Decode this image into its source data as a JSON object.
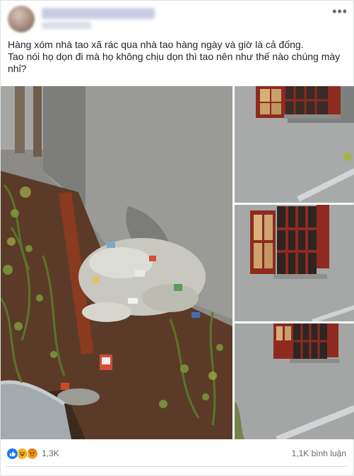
{
  "post": {
    "text_line1": "Hàng xóm nhà tao xã rác qua nhà tao hàng ngày và giờ là cả đống.",
    "text_line2": "Tao nói họ dọn đi mà họ không chịu dọn thì tao nên như thế nào chúng mày nhỉ?"
  },
  "header": {
    "more_glyph": "•••"
  },
  "photos": [
    {
      "subject": "trash pile beside wall"
    },
    {
      "subject": "window with red shutters"
    },
    {
      "subject": "window with red shutters"
    },
    {
      "subject": "window with red shutters"
    }
  ],
  "footer": {
    "reaction_count": "1,3K",
    "comment_count": "1,1K bình luận",
    "reactions": [
      "like-icon",
      "haha-icon",
      "angry-icon"
    ]
  },
  "colors": {
    "like_blue": "#1877f2",
    "text": "#1d2129",
    "meta": "#606770",
    "shutter_red": "#8e2a1f"
  }
}
